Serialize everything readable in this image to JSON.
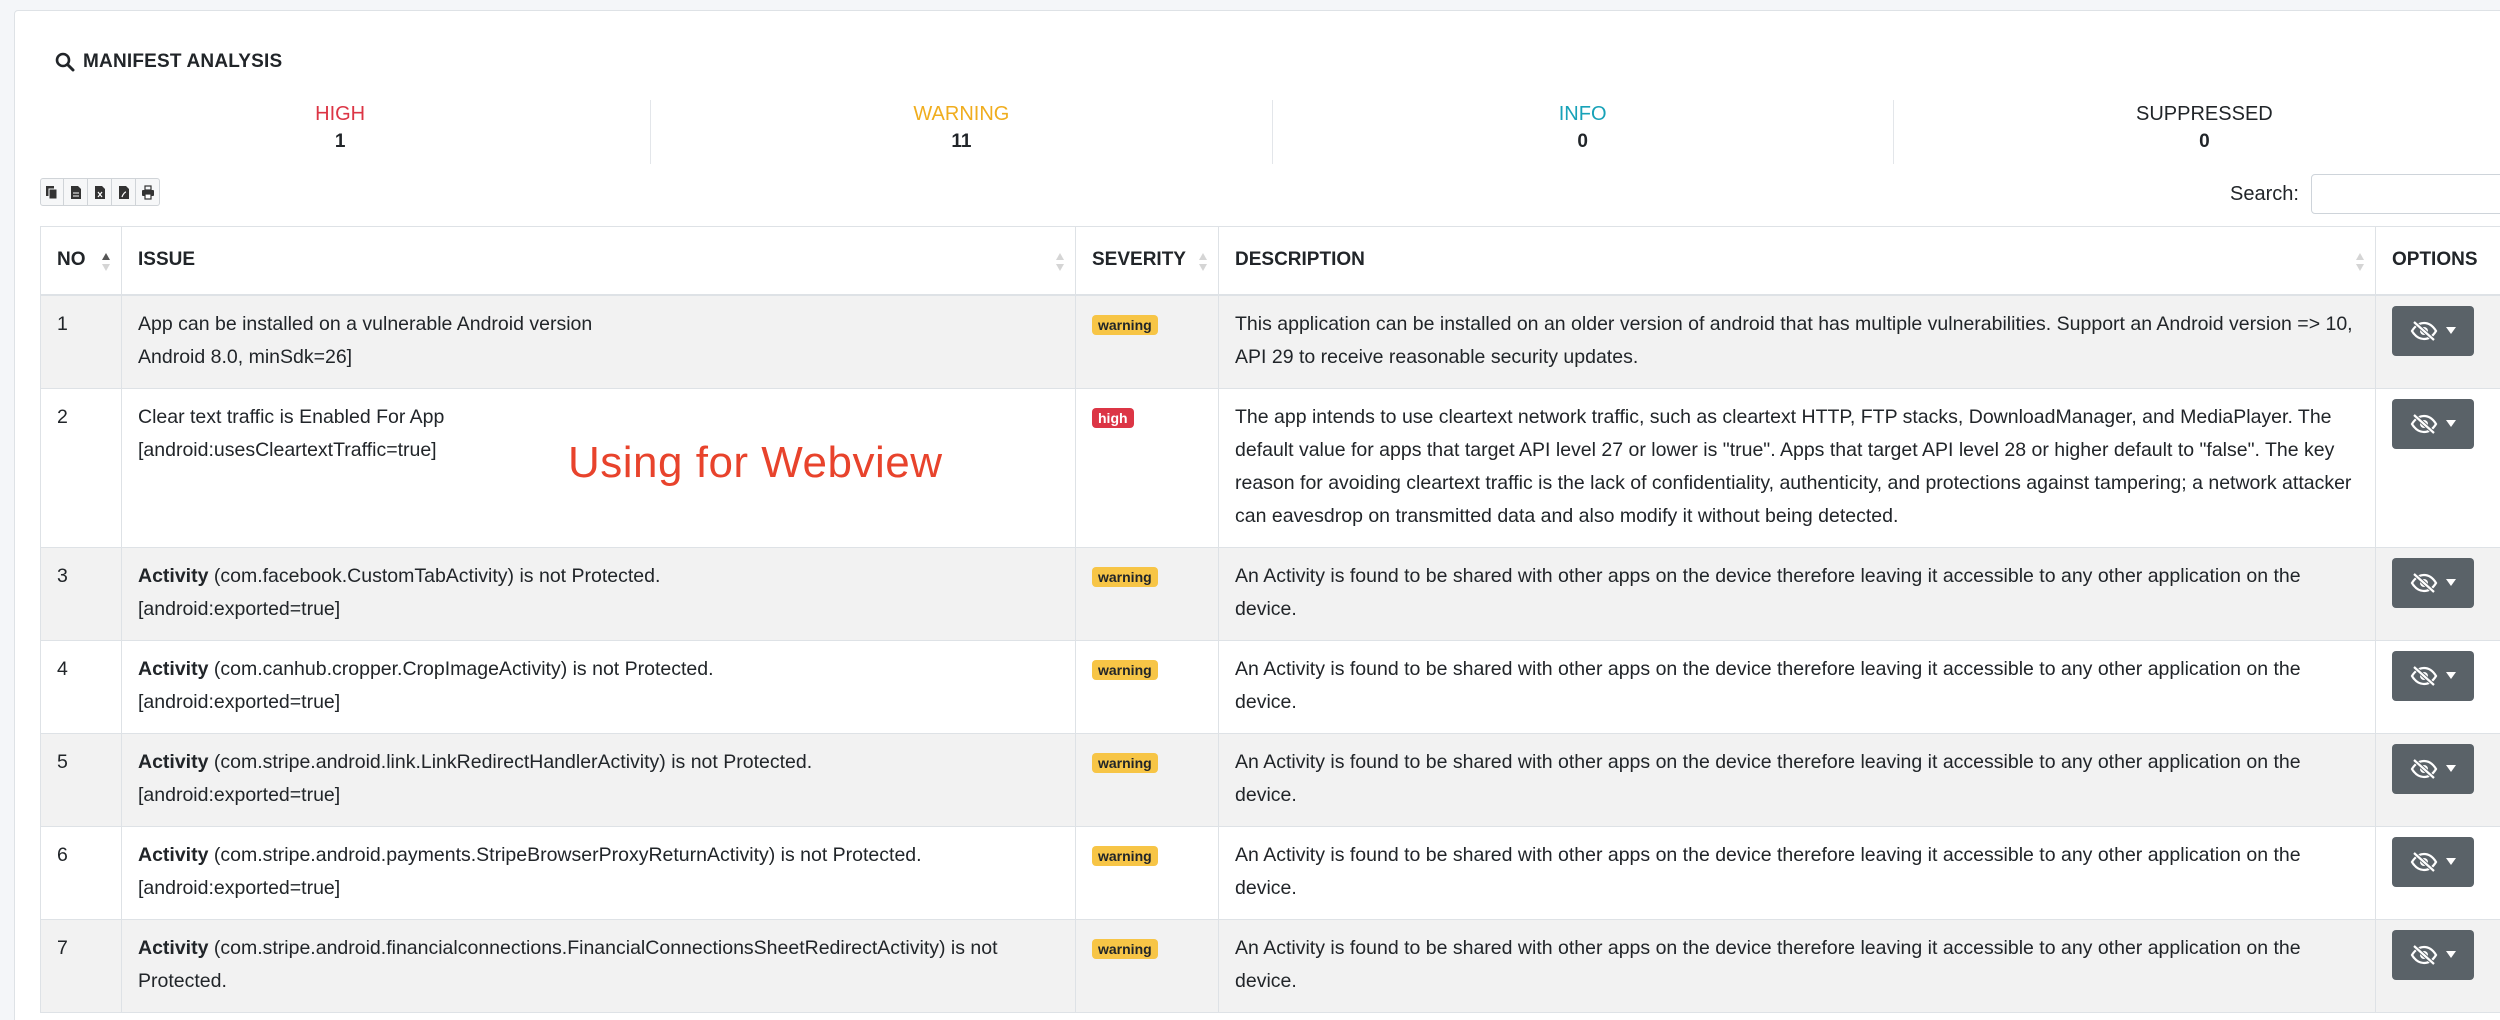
{
  "section": {
    "title": "MANIFEST ANALYSIS",
    "icon": "search-icon"
  },
  "stats": [
    {
      "label": "HIGH",
      "value": "1",
      "color": "#dc3545"
    },
    {
      "label": "WARNING",
      "value": "11",
      "color": "#f0ad1e"
    },
    {
      "label": "INFO",
      "value": "0",
      "color": "#17a2b8"
    },
    {
      "label": "SUPPRESSED",
      "value": "0",
      "color": "#212529"
    }
  ],
  "toolbar": {
    "buttons": [
      "copy-icon",
      "csv-icon",
      "excel-icon",
      "pdf-icon",
      "print-icon"
    ]
  },
  "search": {
    "label": "Search:",
    "value": ""
  },
  "table": {
    "columns": [
      "NO",
      "ISSUE",
      "SEVERITY",
      "DESCRIPTION",
      "OPTIONS"
    ],
    "rows": [
      {
        "no": "1",
        "bold": "",
        "line1": "App can be installed on a vulnerable Android version",
        "line2": "Android 8.0, minSdk=26]",
        "severity": "warning",
        "description": "This application can be installed on an older version of android that has multiple vulnerabilities. Support an Android version => 10, API 29 to receive reasonable security updates."
      },
      {
        "no": "2",
        "bold": "",
        "line1": "Clear text traffic is Enabled For App",
        "line2": "[android:usesCleartextTraffic=true]",
        "severity": "high",
        "description": "The app intends to use cleartext network traffic, such as cleartext HTTP, FTP stacks, DownloadManager, and MediaPlayer. The default value for apps that target API level 27 or lower is \"true\". Apps that target API level 28 or higher default to \"false\". The key reason for avoiding cleartext traffic is the lack of confidentiality, authenticity, and protections against tampering; a network attacker can eavesdrop on transmitted data and also modify it without being detected."
      },
      {
        "no": "3",
        "bold": "Activity",
        "line1": " (com.facebook.CustomTabActivity) is not Protected.",
        "line2": "[android:exported=true]",
        "severity": "warning",
        "description": "An Activity is found to be shared with other apps on the device therefore leaving it accessible to any other application on the device."
      },
      {
        "no": "4",
        "bold": "Activity",
        "line1": " (com.canhub.cropper.CropImageActivity) is not Protected.",
        "line2": "[android:exported=true]",
        "severity": "warning",
        "description": "An Activity is found to be shared with other apps on the device therefore leaving it accessible to any other application on the device."
      },
      {
        "no": "5",
        "bold": "Activity",
        "line1": " (com.stripe.android.link.LinkRedirectHandlerActivity) is not Protected.",
        "line2": "[android:exported=true]",
        "severity": "warning",
        "description": "An Activity is found to be shared with other apps on the device therefore leaving it accessible to any other application on the device."
      },
      {
        "no": "6",
        "bold": "Activity",
        "line1": " (com.stripe.android.payments.StripeBrowserProxyReturnActivity) is not Protected.",
        "line2": "[android:exported=true]",
        "severity": "warning",
        "description": "An Activity is found to be shared with other apps on the device therefore leaving it accessible to any other application on the device."
      },
      {
        "no": "7",
        "bold": "Activity",
        "line1": " (com.stripe.android.financialconnections.FinancialConnectionsSheetRedirectActivity) is not Protected.",
        "line2": "",
        "severity": "warning",
        "description": "An Activity is found to be shared with other apps on the device therefore leaving it accessible to any other application on the device."
      }
    ]
  },
  "annotation": {
    "text": "Using for Webview",
    "color": "#e8432c"
  }
}
